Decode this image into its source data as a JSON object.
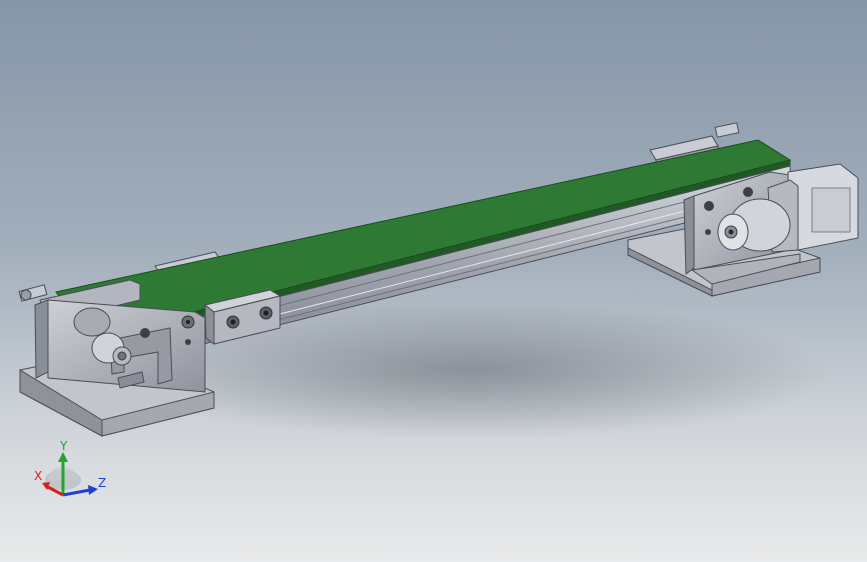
{
  "viewport": {
    "background_top": "#8696a8",
    "background_bottom": "#e9eaeb"
  },
  "model": {
    "belt_color": "#2e7a35",
    "frame_color": "#b9bcc5",
    "motor_color": "#c9ccd2"
  },
  "triad": {
    "x_label": "X",
    "y_label": "Y",
    "z_label": "Z",
    "x_color": "#d42020",
    "y_color": "#22a52a",
    "z_color": "#2040d0"
  }
}
